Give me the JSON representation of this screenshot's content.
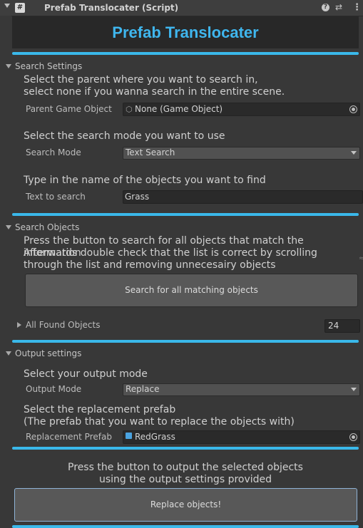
{
  "header": {
    "title": "Prefab Translocater (Script)",
    "script_icon": "#",
    "help_icon": "?",
    "preset_icon": "⇄",
    "menu_icon": "⋮"
  },
  "banner": {
    "title": "Prefab Translocater",
    "color": "#3fb6ee"
  },
  "search_settings": {
    "title": "Search Settings",
    "desc_parent_1": "Select the parent where you want to search in,",
    "desc_parent_2": "select none if you wanna search in the entire scene.",
    "parent_label": "Parent Game Object",
    "parent_value": "None (Game Object)",
    "desc_mode": "Select the search mode you want to use",
    "mode_label": "Search Mode",
    "mode_value": "Text Search",
    "desc_text": "Type in the name of the objects you want to find",
    "text_label": "Text  to search",
    "text_value": "Grass"
  },
  "search_objects": {
    "title": "Search Objects",
    "desc_1": "Press the button to search for all objects that match the information",
    "desc_2": "Afterwards double check that the list is correct by scrolling",
    "desc_3": "through the list and removing unnecesairy objects",
    "button_label": "Search for all matching objects",
    "found_label": "All Found Objects",
    "found_count": "24"
  },
  "output_settings": {
    "title": "Output settings",
    "desc_mode": "Select your output mode",
    "mode_label": "Output Mode",
    "mode_value": "Replace",
    "desc_prefab_1": "Select the replacement prefab",
    "desc_prefab_2": "(The prefab that you want to replace the objects with)",
    "prefab_label": "Replacement Prefab",
    "prefab_value": "RedGrass"
  },
  "output": {
    "desc_1": "Press the button to output the selected objects",
    "desc_2": "using the output settings provided",
    "button_label": "Replace objects!"
  },
  "colors": {
    "accent": "#3ab8ea",
    "background": "#383838"
  }
}
